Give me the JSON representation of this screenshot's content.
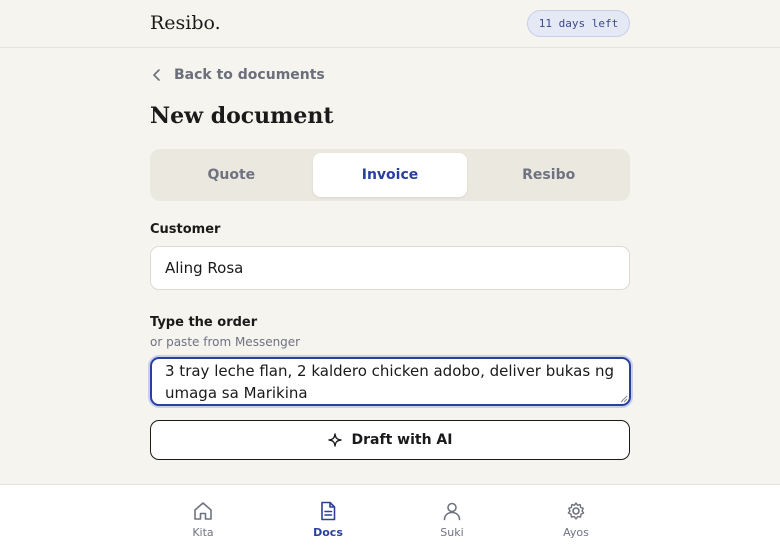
{
  "app": {
    "brand": "Resibo.",
    "trial_badge": "11 days left"
  },
  "nav": {
    "back_label": "Back to documents"
  },
  "page": {
    "title": "New document"
  },
  "doc_type_tabs": [
    {
      "label": "Quote",
      "active": false
    },
    {
      "label": "Invoice",
      "active": true
    },
    {
      "label": "Resibo",
      "active": false
    }
  ],
  "form": {
    "customer_label": "Customer",
    "customer_value": "Aling Rosa",
    "order_label": "Type the order",
    "order_hint": "or paste from Messenger",
    "order_value": "3 tray leche flan, 2 kaldero chicken adobo, deliver bukas ng umaga sa Marikina",
    "draft_button": "Draft with AI"
  },
  "bottom_nav": [
    {
      "label": "Kita",
      "icon": "home-icon",
      "active": false
    },
    {
      "label": "Docs",
      "icon": "document-icon",
      "active": true
    },
    {
      "label": "Suki",
      "icon": "user-icon",
      "active": false
    },
    {
      "label": "Ayos",
      "icon": "settings-icon",
      "active": false
    }
  ],
  "colors": {
    "accent": "#2b3f9e",
    "background": "#f6f4ef",
    "muted_text": "#6f7380"
  }
}
